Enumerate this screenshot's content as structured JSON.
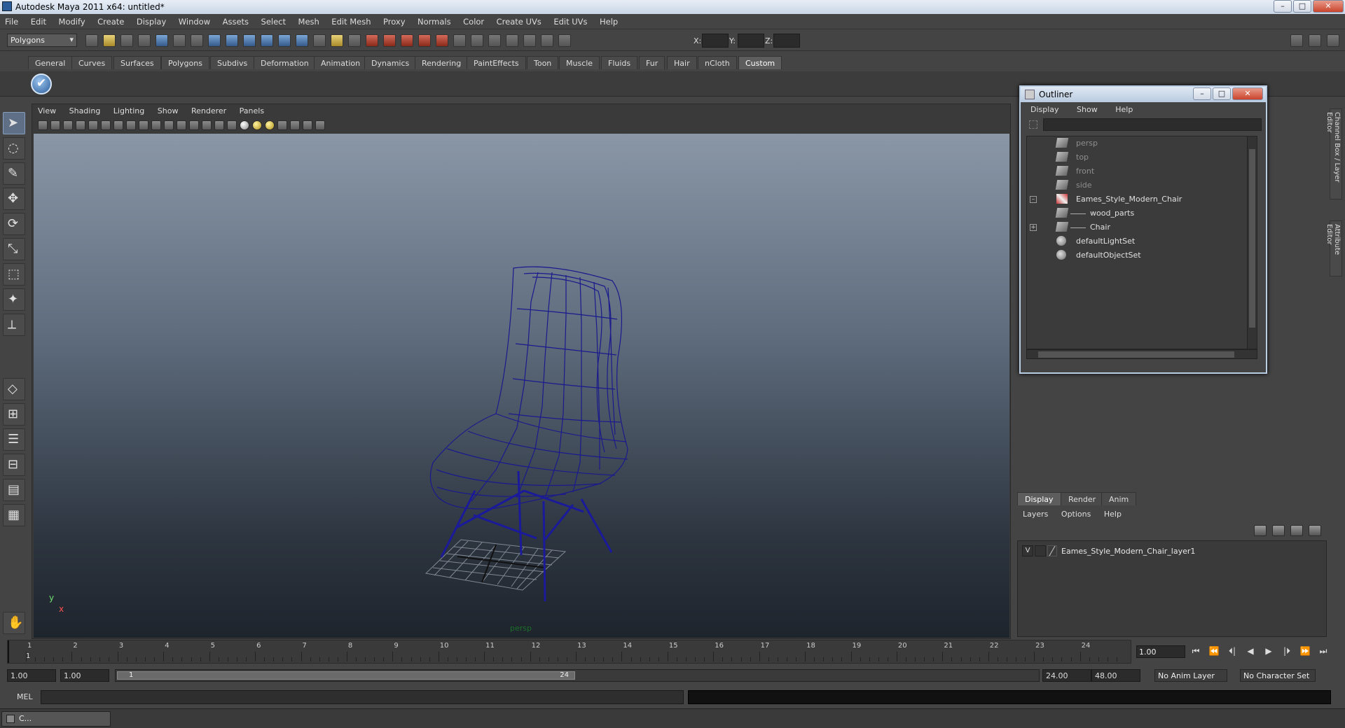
{
  "app": {
    "title": "Autodesk Maya 2011 x64: untitled*",
    "window_controls": [
      "–",
      "□",
      "✕"
    ]
  },
  "menubar": [
    "File",
    "Edit",
    "Modify",
    "Create",
    "Display",
    "Window",
    "Assets",
    "Select",
    "Mesh",
    "Edit Mesh",
    "Proxy",
    "Normals",
    "Color",
    "Create UVs",
    "Edit UVs",
    "Help"
  ],
  "toolbar": {
    "mode": "Polygons",
    "coords": {
      "x_label": "X:",
      "y_label": "Y:",
      "z_label": "Z:"
    }
  },
  "shelf": {
    "tabs": [
      "General",
      "Curves",
      "Surfaces",
      "Polygons",
      "Subdivs",
      "Deformation",
      "Animation",
      "Dynamics",
      "Rendering",
      "PaintEffects",
      "Toon",
      "Muscle",
      "Fluids",
      "Fur",
      "Hair",
      "nCloth",
      "Custom"
    ],
    "active_tab": "Custom"
  },
  "viewport": {
    "menu": [
      "View",
      "Shading",
      "Lighting",
      "Show",
      "Renderer",
      "Panels"
    ],
    "camera_label": "persp",
    "axis_y": "y",
    "axis_x": "x",
    "wire_color": "#1a1a8c"
  },
  "outliner": {
    "title": "Outliner",
    "menu": [
      "Display",
      "Show",
      "Help"
    ],
    "items": [
      {
        "label": "persp",
        "dim": true
      },
      {
        "label": "top",
        "dim": true
      },
      {
        "label": "front",
        "dim": true
      },
      {
        "label": "side",
        "dim": true
      },
      {
        "label": "Eames_Style_Modern_Chair",
        "expander": "–"
      },
      {
        "label": "wood_parts"
      },
      {
        "label": "Chair",
        "expander": "+"
      },
      {
        "label": "defaultLightSet"
      },
      {
        "label": "defaultObjectSet"
      }
    ]
  },
  "side_tabs": [
    "Channel Box / Layer Editor",
    "Attribute Editor"
  ],
  "layer_editor": {
    "tabs": [
      "Display",
      "Render",
      "Anim"
    ],
    "active_tab": "Display",
    "menu": [
      "Layers",
      "Options",
      "Help"
    ],
    "layers": [
      {
        "visible": "V",
        "name": "Eames_Style_Modern_Chair_layer1"
      }
    ]
  },
  "timeline": {
    "ticks": [
      "1",
      "2",
      "3",
      "4",
      "5",
      "6",
      "7",
      "8",
      "9",
      "10",
      "11",
      "12",
      "13",
      "14",
      "15",
      "16",
      "17",
      "18",
      "19",
      "20",
      "21",
      "22",
      "23",
      "24"
    ],
    "current_frame_label": "1",
    "current_frame": "1.00",
    "start": "1.00",
    "playback_start": "1.00",
    "range_start_label": "1",
    "range_end_label": "24",
    "playback_end": "24.00",
    "end": "48.00",
    "anim_layer": "No Anim Layer",
    "character_set": "No Character Set",
    "playback_buttons": [
      "⏮",
      "⏪",
      "⏴|",
      "◀",
      "▶",
      "|⏵",
      "⏩",
      "⏭"
    ]
  },
  "command_line": {
    "label": "MEL"
  },
  "taskbar": {
    "item": "C..."
  }
}
